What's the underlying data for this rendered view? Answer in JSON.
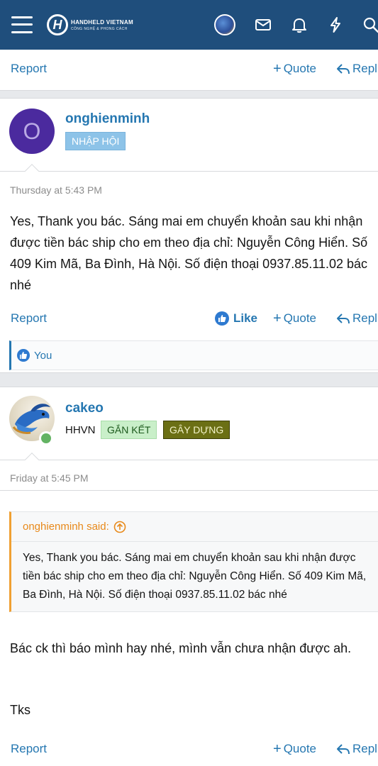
{
  "header": {
    "logo_title": "HANDHELD VIETNAM",
    "logo_subtitle": "CÔNG NGHỆ & PHONG CÁCH",
    "logo_letter": "H"
  },
  "post0": {
    "report": "Report",
    "quote": "Quote",
    "reply": "Repl"
  },
  "post1": {
    "avatar_letter": "O",
    "username": "onghienminh",
    "badge": "NHẬP HỘI",
    "date": "Thursday at 5:43 PM",
    "message": "Yes, Thank you bác. Sáng mai em chuyển khoản sau khi nhận được tiền bác ship cho em theo địa chỉ: Nguyễn Công Hiển. Số 409 Kim Mã, Ba Đình, Hà Nội. Số điện thoại 0937.85.11.02 bác nhé",
    "report": "Report",
    "like": "Like",
    "quote": "Quote",
    "reply": "Repl",
    "likes_text": "You"
  },
  "post2": {
    "username": "cakeo",
    "group": "HHVN",
    "badge1": "GẮN KẾT",
    "badge2": "GÂY DỰNG",
    "date": "Friday at 5:45 PM",
    "quote_author": "onghienminh said:",
    "quote_text": "Yes, Thank you bác. Sáng mai em chuyển khoản sau khi nhận được tiền bác ship cho em theo địa chỉ: Nguyễn Công Hiển. Số 409 Kim Mã, Ba Đình, Hà Nội. Số điện thoại 0937.85.11.02 bác nhé",
    "message_line1": "Bác ck thì báo mình hay nhé, mình vẫn chưa nhận được ah.",
    "message_line2": "Tks",
    "report": "Report",
    "quote": "Quote",
    "reply": "Repl"
  },
  "colors": {
    "header_bg": "#1f4e7c",
    "link": "#2577b1",
    "badge_blue": "#8dc3e8",
    "badge_green": "#c9efc9",
    "badge_olive": "#6b6f14",
    "quote_accent": "#f0a032"
  },
  "icons": [
    "menu-icon",
    "logo-icon",
    "mail-icon",
    "bell-icon",
    "bolt-icon",
    "search-icon",
    "like-icon",
    "quote-up-icon",
    "reply-icon"
  ]
}
